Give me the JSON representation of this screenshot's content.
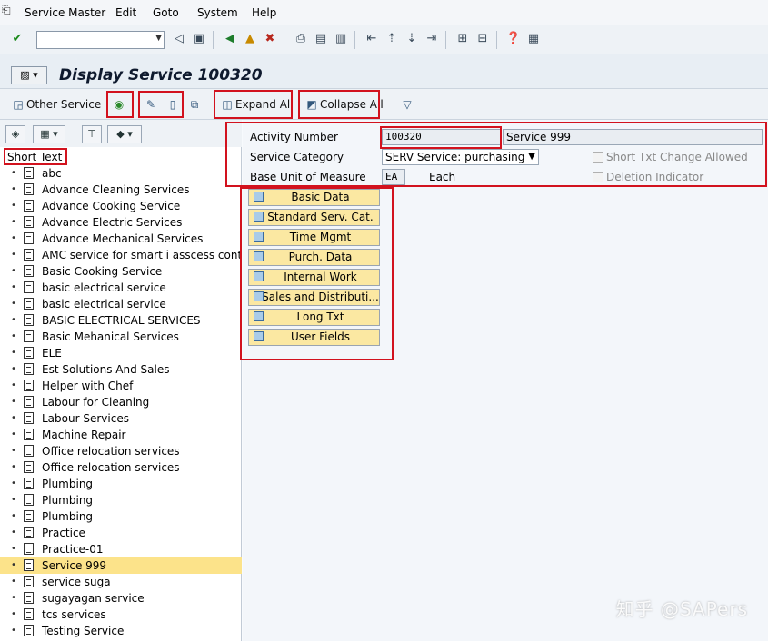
{
  "menubar": {
    "items": [
      "Service Master",
      "Edit",
      "Goto",
      "System",
      "Help"
    ]
  },
  "toolbar1": {
    "command_field_value": ""
  },
  "header": {
    "title": "Display Service 100320"
  },
  "toolbar2": {
    "other_service": "Other Service",
    "expand_all": "Expand All",
    "collapse_all": "Collapse All"
  },
  "left_pane": {
    "column_header": "Short Text",
    "items": [
      "abc",
      "Advance Cleaning Services",
      "Advance Cooking Service",
      "Advance Electric Services",
      "Advance Mechanical Services",
      "AMC service for smart i asscess control",
      "Basic Cooking Service",
      "basic electrical service",
      "basic electrical service",
      "BASIC ELECTRICAL SERVICES",
      "Basic Mehanical Services",
      "ELE",
      "Est Solutions And Sales",
      "Helper with Chef",
      "Labour for Cleaning",
      "Labour Services",
      "Machine Repair",
      "Office relocation services",
      "Office relocation services",
      "Plumbing",
      "Plumbing",
      "Plumbing",
      "Practice",
      "Practice-01",
      "Service 999",
      "service suga",
      "sugayagan service",
      "tcs services",
      "Testing Service"
    ],
    "selected_index": 24
  },
  "form": {
    "activity_number_label": "Activity Number",
    "activity_number": "100320",
    "short_text": "Service 999",
    "service_category_label": "Service Category",
    "service_category": "SERV Service: purchasing",
    "base_unit_label": "Base Unit of Measure",
    "base_unit": "EA",
    "base_unit_text": "Each",
    "short_txt_change_allowed": "Short Txt Change Allowed",
    "deletion_indicator": "Deletion Indicator"
  },
  "tabs": [
    "Basic Data",
    "Standard Serv. Cat.",
    "Time Mgmt",
    "Purch. Data",
    "Internal Work",
    "Sales and Distributi...",
    "Long Txt",
    "User Fields"
  ],
  "watermark": "知乎 @SAPers",
  "colors": {
    "highlight_box": "#d2121e",
    "selected_row": "#fce38a",
    "tab_button": "#fbe8a2"
  }
}
